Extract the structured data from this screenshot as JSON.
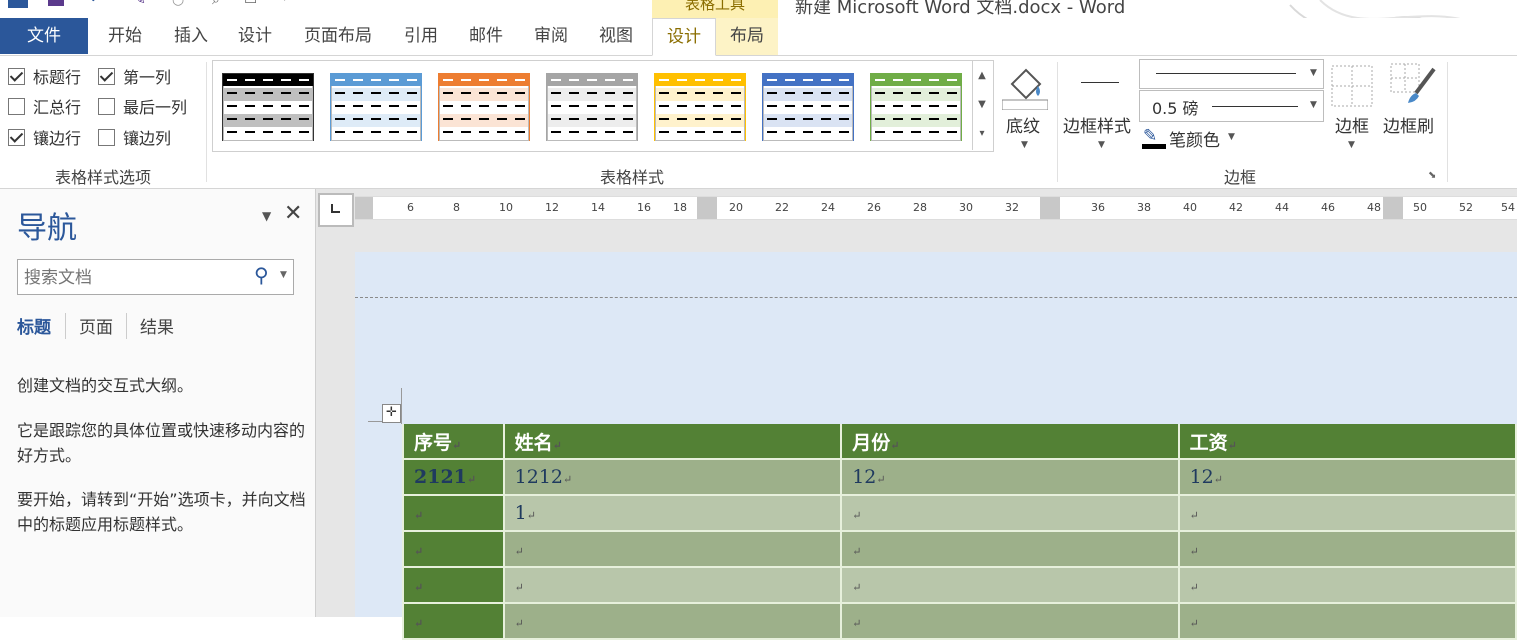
{
  "window": {
    "title": "新建 Microsoft Word 文档.docx - Word",
    "context_tab_group": "表格工具"
  },
  "tabs": [
    "文件",
    "开始",
    "插入",
    "设计",
    "页面布局",
    "引用",
    "邮件",
    "审阅",
    "视图",
    "设计",
    "布局"
  ],
  "active_tab_index": 9,
  "ribbon": {
    "style_options": {
      "group_label": "表格样式选项",
      "items": [
        {
          "label": "标题行",
          "checked": true
        },
        {
          "label": "第一列",
          "checked": true
        },
        {
          "label": "汇总行",
          "checked": false
        },
        {
          "label": "最后一列",
          "checked": false
        },
        {
          "label": "镶边行",
          "checked": true
        },
        {
          "label": "镶边列",
          "checked": false
        }
      ]
    },
    "table_styles": {
      "group_label": "表格样式",
      "swatches": [
        {
          "header": "#000000",
          "band": "#bfbfbf"
        },
        {
          "header": "#5b9bd5",
          "band": "#deebf7"
        },
        {
          "header": "#ed7d31",
          "band": "#fbe4d5"
        },
        {
          "header": "#a5a5a5",
          "band": "#ededed"
        },
        {
          "header": "#ffc000",
          "band": "#fff2cc"
        },
        {
          "header": "#4472c4",
          "band": "#dae3f3"
        },
        {
          "header": "#70ad47",
          "band": "#e2efda"
        }
      ],
      "shading_label": "底纹"
    },
    "borders": {
      "group_label": "边框",
      "border_styles_label": "边框样式",
      "weight_value": "0.5 磅",
      "pen_color_label": "笔颜色",
      "borders_label": "边框",
      "border_painter_label": "边框刷"
    }
  },
  "nav_pane": {
    "title": "导航",
    "search_placeholder": "搜索文档",
    "tabs": [
      "标题",
      "页面",
      "结果"
    ],
    "p1": "创建文档的交互式大纲。",
    "p2": "它是跟踪您的具体位置或快速移动内容的好方式。",
    "p3": "要开始，请转到“开始”选项卡，并向文档中的标题应用标题样式。"
  },
  "ruler": {
    "numbers": [
      "6",
      "8",
      "10",
      "12",
      "14",
      "16",
      "18",
      "20",
      "22",
      "24",
      "26",
      "28",
      "30",
      "32",
      "36",
      "38",
      "40",
      "42",
      "44",
      "46",
      "48",
      "50",
      "52",
      "54"
    ]
  },
  "table": {
    "header": [
      "序号",
      "姓名",
      "月份",
      "工资"
    ],
    "rows": [
      [
        "2121",
        "1212",
        "12",
        "12"
      ],
      [
        "",
        "1",
        "",
        ""
      ],
      [
        "",
        "",
        "",
        ""
      ],
      [
        "",
        "",
        "",
        ""
      ],
      [
        "",
        "",
        "",
        ""
      ]
    ],
    "paragraph_mark": "↵"
  },
  "colors": {
    "file_tab": "#2b579a",
    "header_green": "#538135",
    "band_odd": "#9db08a",
    "band_even": "#b8c6aa"
  }
}
